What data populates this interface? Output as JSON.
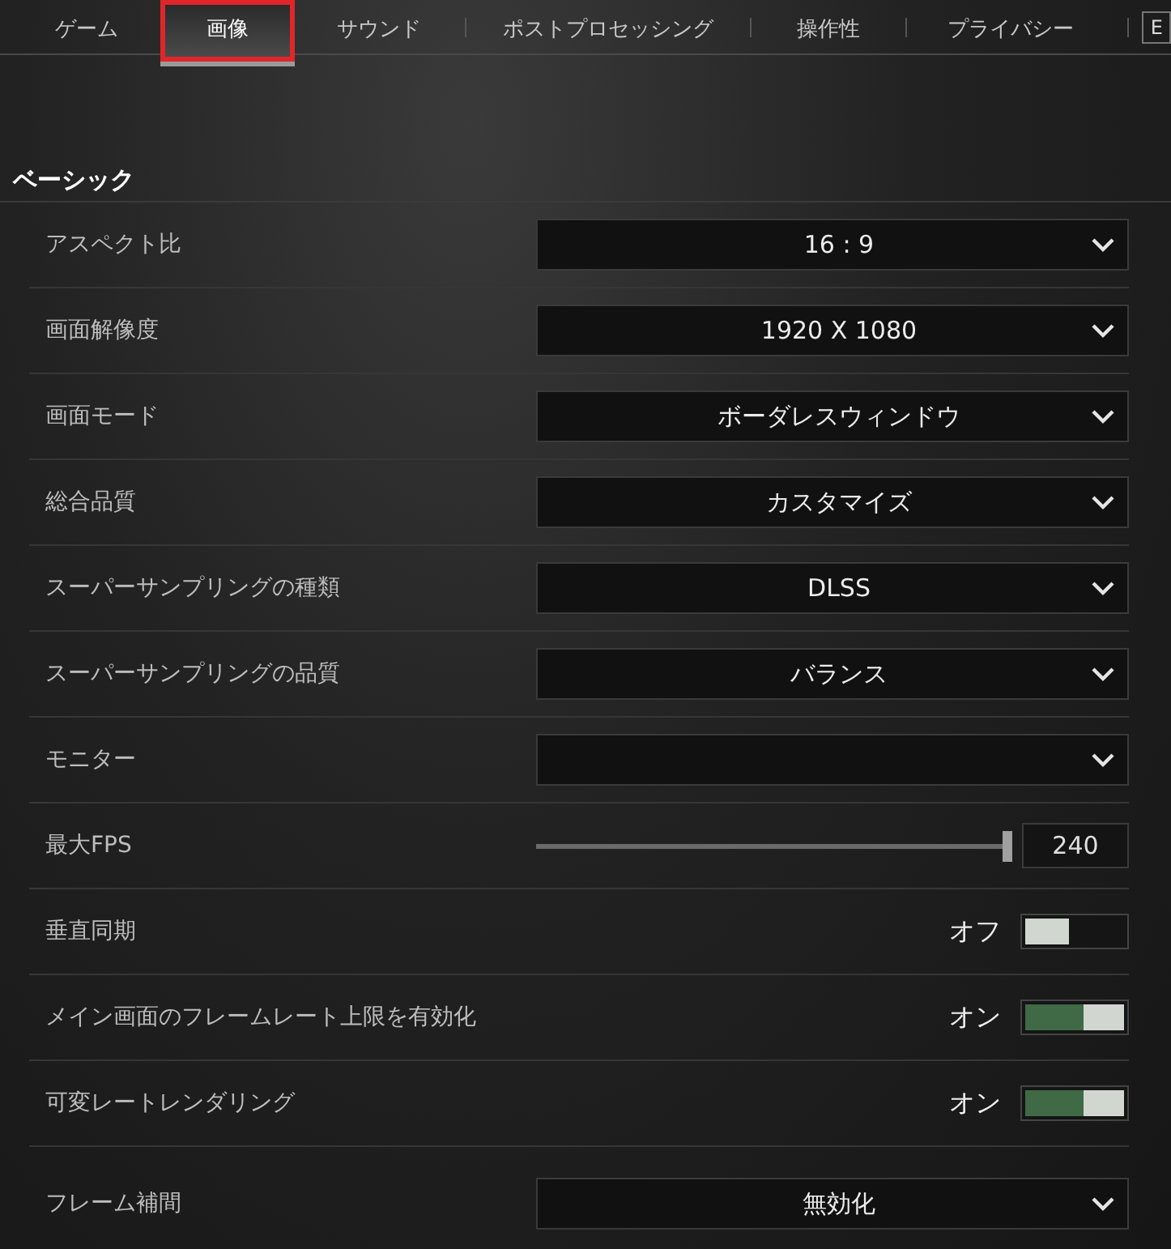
{
  "tabs": [
    {
      "label": "ゲーム",
      "selected": false
    },
    {
      "label": "画像",
      "selected": true
    },
    {
      "label": "サウンド",
      "selected": false
    },
    {
      "label": "ポストプロセッシング",
      "selected": false
    },
    {
      "label": "操作性",
      "selected": false
    },
    {
      "label": "プライバシー",
      "selected": false
    }
  ],
  "key_hint": "E",
  "section": {
    "title": "ベーシック"
  },
  "settings": [
    {
      "kind": "dropdown",
      "label": "アスペクト比",
      "value": "16 : 9"
    },
    {
      "kind": "dropdown",
      "label": "画面解像度",
      "value": "1920 X 1080"
    },
    {
      "kind": "dropdown",
      "label": "画面モード",
      "value": "ボーダレスウィンドウ"
    },
    {
      "kind": "dropdown",
      "label": "総合品質",
      "value": "カスタマイズ"
    },
    {
      "kind": "dropdown",
      "label": "スーパーサンプリングの種類",
      "value": "DLSS"
    },
    {
      "kind": "dropdown",
      "label": "スーパーサンプリングの品質",
      "value": "バランス"
    },
    {
      "kind": "dropdown",
      "label": "モニター"
    },
    {
      "kind": "slider",
      "label": "最大FPS",
      "level": 1,
      "value": "240"
    },
    {
      "kind": "toggle",
      "label": "垂直同期",
      "on": false,
      "value": "オフ"
    },
    {
      "kind": "toggle",
      "label": "メイン画面のフレームレート上限を有効化",
      "on": true,
      "value": "オン"
    },
    {
      "kind": "toggle",
      "label": "可変レートレンダリング",
      "on": true,
      "value": "オン"
    },
    {
      "kind": "dropdown",
      "label": "フレーム補間",
      "value": "無効化"
    }
  ]
}
